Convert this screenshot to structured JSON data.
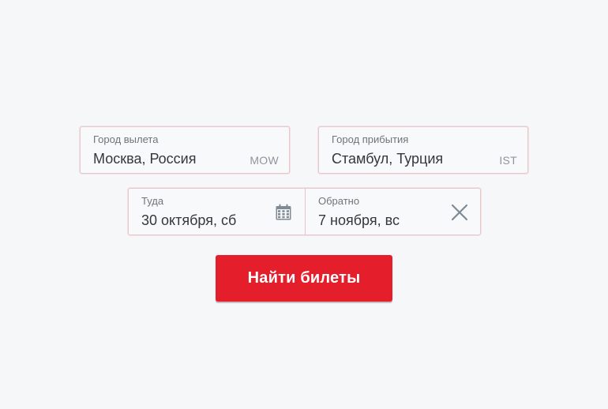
{
  "search_form": {
    "from": {
      "label": "Город вылета",
      "value": "Москва, Россия",
      "code": "MOW"
    },
    "to": {
      "label": "Город прибытия",
      "value": "Стамбул, Турция",
      "code": "IST"
    },
    "depart": {
      "label": "Туда",
      "value": "30 октября, сб",
      "icon": "calendar-icon"
    },
    "return": {
      "label": "Обратно",
      "value": "7 ноября, вс",
      "icon": "close-icon"
    },
    "submit_label": "Найти билеты"
  },
  "colors": {
    "background": "#f6f7f9",
    "field_border": "#e6c7cb",
    "accent": "#e41e2b",
    "icon": "#7f8a93"
  }
}
